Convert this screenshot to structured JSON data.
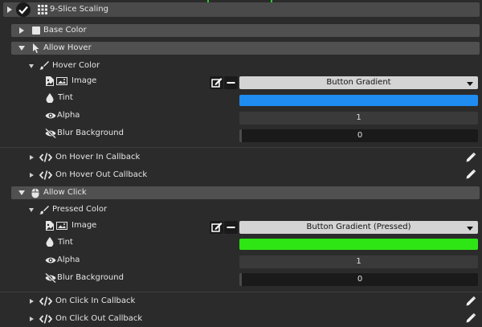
{
  "root": {
    "label": "9-Slice Scaling"
  },
  "sections": {
    "base_color": "Base Color",
    "allow_hover": "Allow Hover",
    "hover_color": "Hover Color",
    "allow_click": "Allow Click",
    "pressed_color": "Pressed Color"
  },
  "hover": {
    "image_label": "Image",
    "image_value": "Button Gradient",
    "tint_label": "Tint",
    "tint_color": "#1e8cf0",
    "alpha_label": "Alpha",
    "alpha_value": "1",
    "blur_label": "Blur Background",
    "blur_value": "0",
    "callback_in": "On Hover In Callback",
    "callback_out": "On Hover Out Callback"
  },
  "click": {
    "image_label": "Image",
    "image_value": "Button Gradient (Pressed)",
    "tint_label": "Tint",
    "tint_color": "#2ee614",
    "alpha_label": "Alpha",
    "alpha_value": "1",
    "blur_label": "Blur Background",
    "blur_value": "0",
    "callback_in": "On Click In Callback",
    "callback_out": "On Click Out Callback"
  }
}
